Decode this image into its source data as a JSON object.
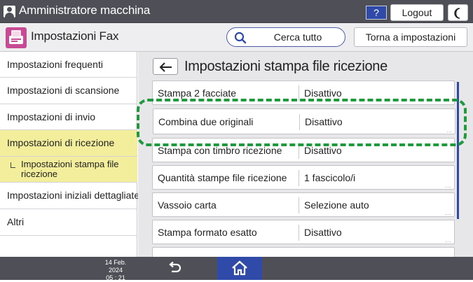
{
  "header": {
    "title": "Amministratore macchina",
    "help_label": "?",
    "logout_label": "Logout"
  },
  "subheader": {
    "app_title": "Impostazioni Fax",
    "search_label": "Cerca tutto",
    "back_to_settings_label": "Torna a impostazioni"
  },
  "sidebar": {
    "items": [
      {
        "label": "Impostazioni frequenti"
      },
      {
        "label": "Impostazioni di scansione"
      },
      {
        "label": "Impostazioni di invio"
      },
      {
        "label": "Impostazioni di ricezione"
      },
      {
        "label": "Impostazioni stampa file ricezione"
      },
      {
        "label": "Impostazioni iniziali dettagliate"
      },
      {
        "label": "Altri"
      }
    ]
  },
  "main": {
    "title": "Impostazioni stampa file ricezione",
    "rows": [
      {
        "name": "Stampa 2 facciate",
        "value": "Disattivo"
      },
      {
        "name": "Stampa con timbro ricezione",
        "value": "Disattivo"
      },
      {
        "name": "Quantità stampe file ricezione",
        "value": "1 fascicolo/i"
      },
      {
        "name": "Vassoio carta",
        "value": "Selezione auto"
      },
      {
        "name": "Stampa formato esatto",
        "value": "Disattivo"
      }
    ],
    "highlighted_row": {
      "name": "Combina due originali",
      "value": "Disattivo"
    }
  },
  "footer": {
    "date": "14 Feb. 2024",
    "time": "05 : 21"
  },
  "colors": {
    "topbar": "#4f5057",
    "accent_blue": "#2f4aa8",
    "selected_yellow": "#f3ee9c",
    "highlight_green": "#1e9a3c",
    "fax_icon_pink": "#c84a95"
  },
  "icons": {
    "admin": "person-icon",
    "dark_mode": "moon-icon",
    "fax": "fax-icon",
    "search": "search-icon",
    "back": "arrow-left-icon",
    "return": "return-arrow-icon",
    "home": "home-icon"
  }
}
